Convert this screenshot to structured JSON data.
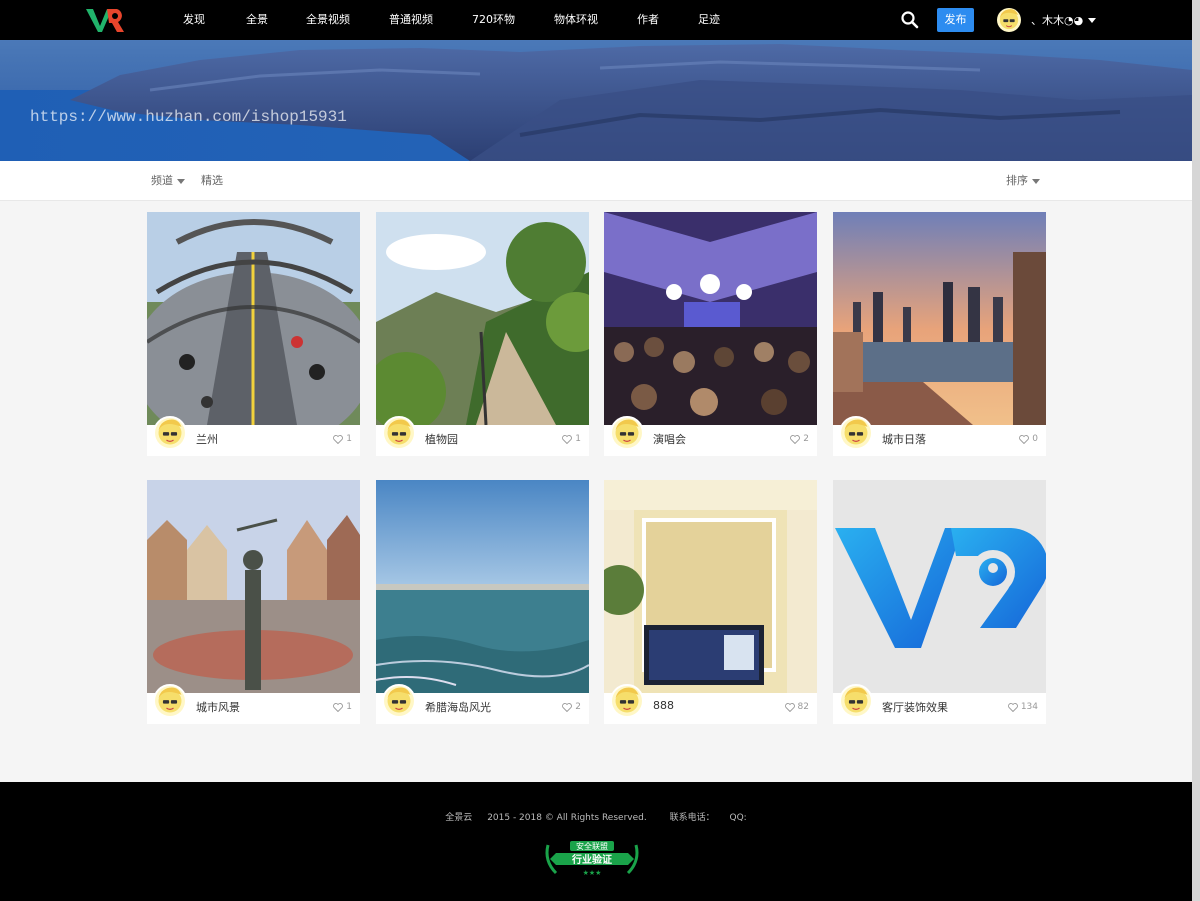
{
  "nav": {
    "items": [
      "发现",
      "全景",
      "全景视频",
      "普通视频",
      "720环物",
      "物体环视",
      "作者",
      "足迹"
    ],
    "publish_label": "发布",
    "username": "、木木◔◕"
  },
  "banner": {
    "watermark": "https://www.huzhan.com/ishop15931"
  },
  "filter": {
    "channel_label": "频道",
    "select_label": "精选",
    "sort_label": "排序"
  },
  "cards": [
    {
      "title": "兰州",
      "likes": "1",
      "scene": "bridge"
    },
    {
      "title": "植物园",
      "likes": "1",
      "scene": "garden"
    },
    {
      "title": "演唱会",
      "likes": "2",
      "scene": "concert"
    },
    {
      "title": "城市日落",
      "likes": "0",
      "scene": "sunset"
    },
    {
      "title": "城市风景",
      "likes": "1",
      "scene": "square"
    },
    {
      "title": "希腊海岛风光",
      "likes": "2",
      "scene": "sea"
    },
    {
      "title": "888",
      "likes": "82",
      "scene": "livingroom"
    },
    {
      "title": "客厅装饰效果",
      "likes": "134",
      "scene": "vrlogo"
    }
  ],
  "footer": {
    "brand": "全景云",
    "copyright": "2015 - 2018 © All Rights Reserved.",
    "phone_label": "联系电话：",
    "qq_label": "QQ:",
    "badge_top": "安全联盟",
    "badge_main": "行业验证"
  },
  "colors": {
    "nav_bg": "#000000",
    "publish_blue": "#2d8cf0",
    "footer_bg": "#000000",
    "badge_green": "#1aa34a"
  }
}
